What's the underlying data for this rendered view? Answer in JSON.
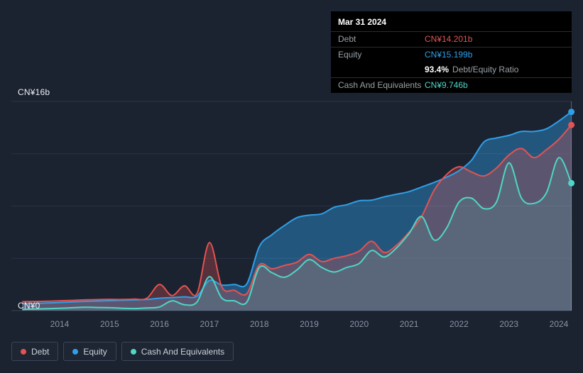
{
  "colors": {
    "background": "#1b2230",
    "debt": "#e25353",
    "equity": "#2f9fe8",
    "cash": "#4fd6c5",
    "debt_fill": "rgba(226,83,83,0.30)",
    "equity_fill": "rgba(47,159,232,0.42)",
    "cash_fill": "rgba(79,214,197,0.14)",
    "grid": "#2b3545",
    "axis_text": "#8b95a6",
    "tooltip_bg": "#000000"
  },
  "tooltip": {
    "date": "Mar 31 2024",
    "rows": [
      {
        "label": "Debt",
        "value": "CN¥14.201b",
        "color_key": "debt"
      },
      {
        "label": "Equity",
        "value": "CN¥15.199b",
        "color_key": "equity"
      },
      {
        "label": "Cash And Equivalents",
        "value": "CN¥9.746b",
        "color_key": "cash"
      }
    ],
    "ratio": {
      "value": "93.4%",
      "label": "Debt/Equity Ratio"
    }
  },
  "legend": {
    "items": [
      {
        "label": "Debt",
        "color_key": "debt"
      },
      {
        "label": "Equity",
        "color_key": "equity"
      },
      {
        "label": "Cash And Equivalents",
        "color_key": "cash"
      }
    ]
  },
  "chart_data": {
    "type": "area",
    "unit": "CN¥ billions",
    "x": [
      2013.25,
      2013.5,
      2013.75,
      2014,
      2014.25,
      2014.5,
      2014.75,
      2015,
      2015.25,
      2015.5,
      2015.75,
      2016,
      2016.25,
      2016.5,
      2016.75,
      2017,
      2017.25,
      2017.5,
      2017.75,
      2018,
      2018.25,
      2018.5,
      2018.75,
      2019,
      2019.25,
      2019.5,
      2019.75,
      2020,
      2020.25,
      2020.5,
      2020.75,
      2021,
      2021.25,
      2021.5,
      2021.75,
      2022,
      2022.25,
      2022.5,
      2022.75,
      2023,
      2023.25,
      2023.5,
      2023.75,
      2024,
      2024.25
    ],
    "series": [
      {
        "name": "Equity",
        "color_key": "equity",
        "values": [
          0.52,
          0.55,
          0.58,
          0.62,
          0.66,
          0.7,
          0.73,
          0.76,
          0.79,
          0.82,
          0.85,
          0.95,
          1.0,
          1.05,
          1.1,
          2.3,
          1.95,
          2.0,
          2.05,
          4.9,
          5.8,
          6.5,
          7.1,
          7.3,
          7.4,
          7.9,
          8.1,
          8.4,
          8.45,
          8.7,
          8.9,
          9.1,
          9.45,
          9.8,
          10.2,
          10.7,
          11.5,
          12.9,
          13.2,
          13.4,
          13.7,
          13.7,
          13.9,
          14.5,
          15.199
        ]
      },
      {
        "name": "Debt",
        "color_key": "debt",
        "values": [
          0.68,
          0.7,
          0.72,
          0.75,
          0.78,
          0.82,
          0.84,
          0.86,
          0.85,
          0.88,
          0.95,
          2.0,
          1.15,
          1.9,
          1.3,
          5.2,
          1.8,
          1.55,
          1.3,
          3.5,
          3.2,
          3.45,
          3.7,
          4.3,
          3.75,
          4.0,
          4.2,
          4.55,
          5.3,
          4.45,
          5.0,
          6.0,
          7.2,
          9.2,
          10.4,
          11.0,
          10.6,
          10.3,
          10.9,
          11.9,
          12.4,
          11.7,
          12.3,
          13.1,
          14.201
        ]
      },
      {
        "name": "Cash And Equivalents",
        "color_key": "cash",
        "values": [
          0.1,
          0.12,
          0.15,
          0.18,
          0.22,
          0.26,
          0.24,
          0.22,
          0.18,
          0.16,
          0.2,
          0.28,
          0.75,
          0.45,
          0.65,
          2.6,
          0.95,
          0.75,
          0.65,
          3.3,
          2.9,
          2.55,
          3.1,
          3.9,
          3.3,
          2.95,
          3.3,
          3.6,
          4.6,
          4.1,
          4.8,
          5.9,
          7.2,
          5.4,
          6.3,
          8.3,
          8.6,
          7.8,
          8.3,
          11.3,
          8.6,
          8.2,
          9.0,
          11.7,
          9.746
        ]
      }
    ],
    "x_axis": {
      "ticks": [
        "2014",
        "2015",
        "2016",
        "2017",
        "2018",
        "2019",
        "2020",
        "2021",
        "2022",
        "2023",
        "2024"
      ]
    },
    "y_axis": {
      "min": 0,
      "max": 16,
      "min_label": "CN¥0",
      "max_label": "CN¥16b",
      "gridline_values": [
        0,
        4,
        8,
        12,
        16
      ]
    },
    "hover_x": 2024.25,
    "end_markers": true
  }
}
